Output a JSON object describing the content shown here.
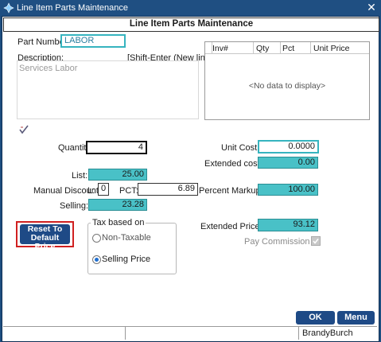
{
  "window": {
    "title": "Line Item Parts Maintenance",
    "close_glyph": "✕"
  },
  "header": {
    "title": "Line Item Parts Maintenance"
  },
  "part": {
    "number_label": "Part Number:",
    "number_value": "LABOR",
    "description_label": "Description:",
    "description_hint": "[Shift-Enter (New line)]",
    "description_value": "Services Labor"
  },
  "grid": {
    "columns": [
      "Inv#",
      "Qty",
      "Pct",
      "Unit Price"
    ],
    "empty_text": "<No data to display>"
  },
  "pricing": {
    "quantity_label": "Quantity:",
    "quantity_value": "4",
    "list_label": "List:",
    "list_value": "25.00",
    "manual_discount_label": "Manual Discount",
    "l_label": "L:",
    "l_value": "0",
    "pct_label": "PCT:",
    "pct_value": "6.89",
    "selling_label": "Selling:",
    "selling_value": "23.28",
    "unit_cost_label": "Unit Cost:",
    "unit_cost_value": "0.0000",
    "extended_cost_label": "Extended cost:",
    "extended_cost_value": "0.00",
    "percent_markup_label": "Percent Markup:",
    "percent_markup_value": "100.00",
    "extended_price_label": "Extended Price:",
    "extended_price_value": "93.12",
    "pay_commission_label": "Pay Commission",
    "pay_commission_checked": true
  },
  "tax": {
    "group_label": "Tax based on",
    "option_non_taxable": "Non-Taxable",
    "option_selling_price": "Selling Price",
    "selected": "Selling Price"
  },
  "buttons": {
    "reset_line1": "Reset To",
    "reset_line2": "Default Price",
    "ok": "OK",
    "menu": "Menu"
  },
  "status": {
    "user": "BrandyBurch"
  },
  "colors": {
    "titlebar": "#1f4f82",
    "teal": "#49c1c7",
    "button": "#1e4a86",
    "highlight_red": "#d02020"
  }
}
